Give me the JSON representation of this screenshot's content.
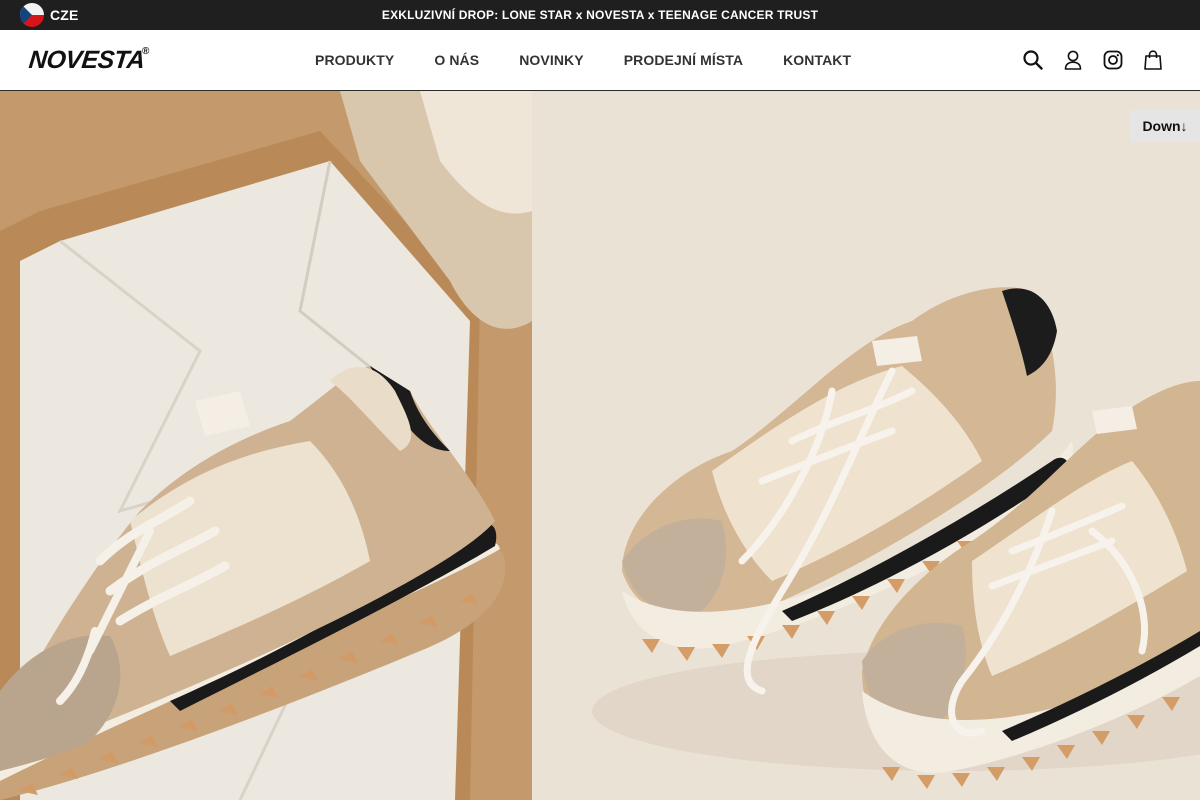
{
  "topbar": {
    "language": "CZE",
    "announcement": "EXKLUZIVNÍ DROP: LONE STAR x NOVESTA x TEENAGE CANCER TRUST"
  },
  "header": {
    "logo_text": "NOVESTA",
    "logo_mark": "®",
    "nav": [
      {
        "label": "PRODUKTY"
      },
      {
        "label": "O NÁS"
      },
      {
        "label": "NOVINKY"
      },
      {
        "label": "PRODEJNÍ MÍSTA"
      },
      {
        "label": "KONTAKT"
      }
    ],
    "icons": [
      "search-icon",
      "user-icon",
      "instagram-icon",
      "shopping-bag-icon"
    ]
  },
  "hero": {
    "down_button": "Down↓"
  },
  "colors": {
    "topbar_bg": "#1f1f1f",
    "text_dark": "#111111",
    "nav_text": "#333333",
    "down_button_bg": "#e5e5e5"
  }
}
